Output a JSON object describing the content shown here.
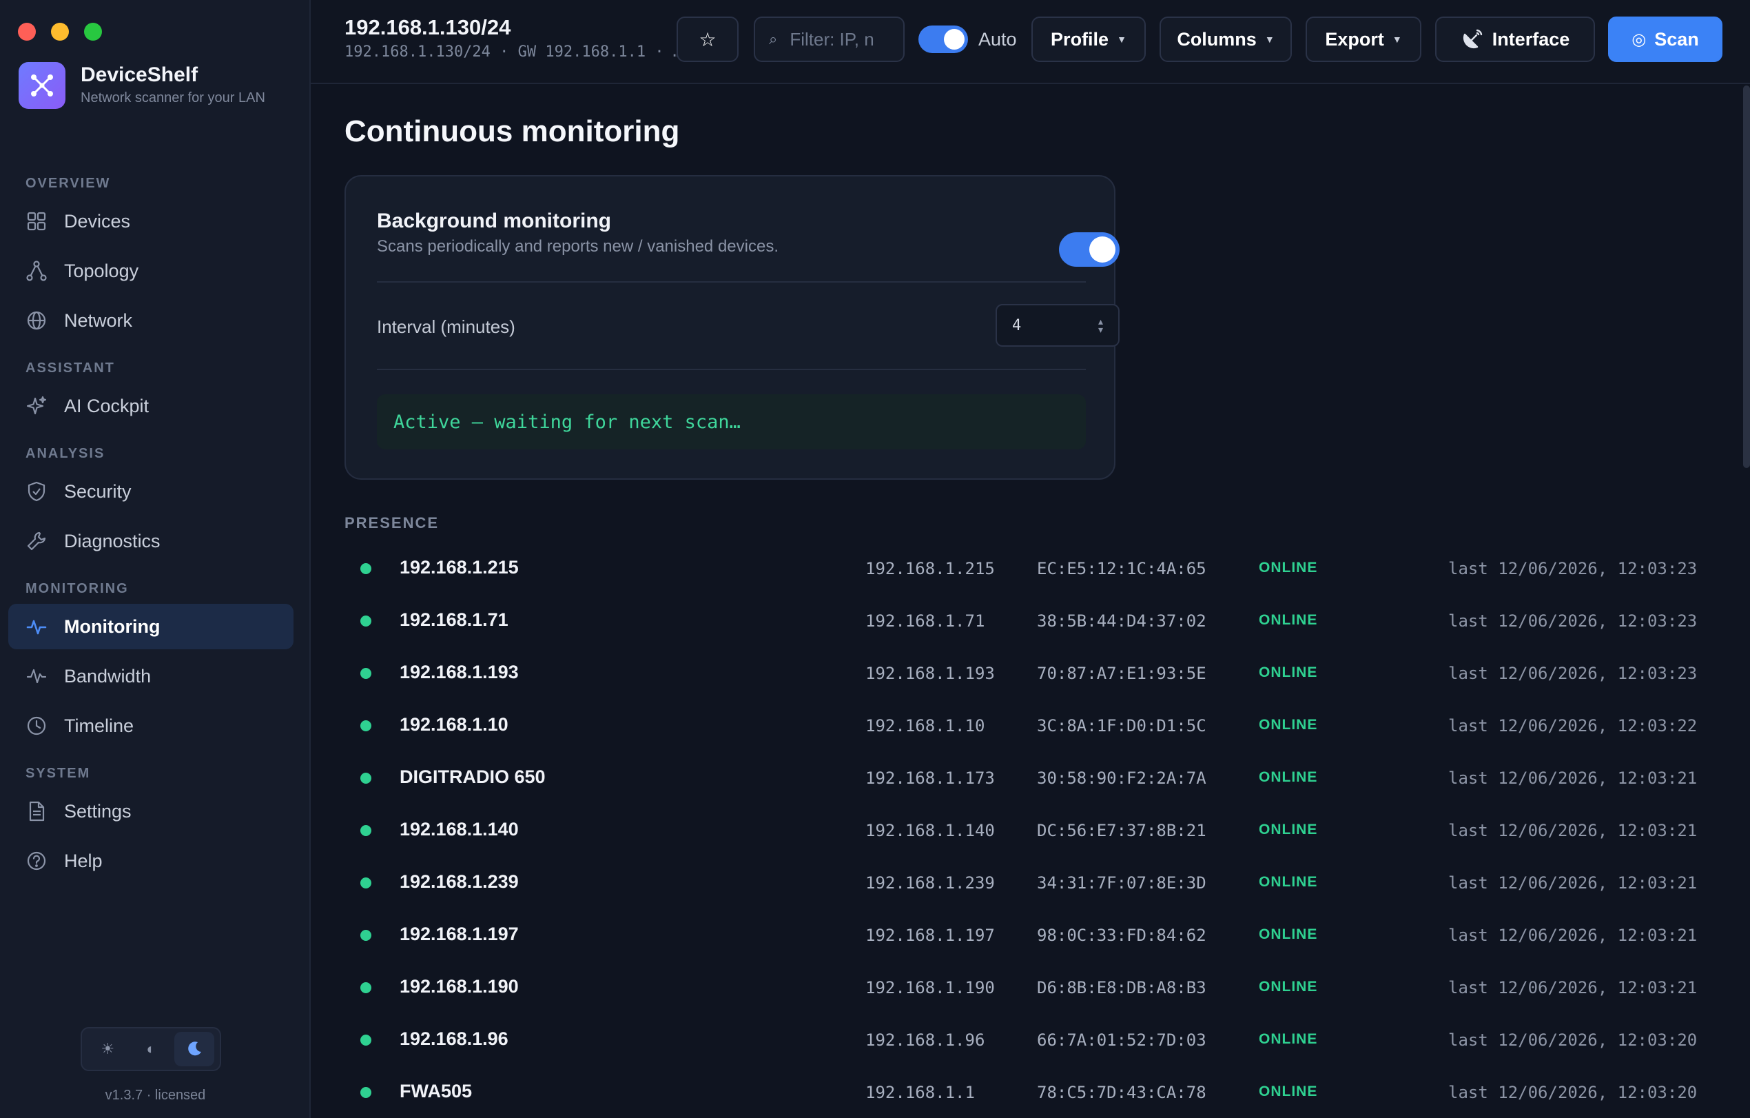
{
  "app": {
    "name": "DeviceShelf",
    "tagline": "Network scanner for your LAN",
    "version": "v1.3.7 · licensed"
  },
  "sidebar": {
    "sections": [
      {
        "title": "OVERVIEW",
        "items": [
          {
            "label": "Devices",
            "icon": "grid-icon"
          },
          {
            "label": "Topology",
            "icon": "topology-icon"
          },
          {
            "label": "Network",
            "icon": "globe-icon"
          }
        ]
      },
      {
        "title": "ASSISTANT",
        "items": [
          {
            "label": "AI Cockpit",
            "icon": "sparkle-icon"
          }
        ]
      },
      {
        "title": "ANALYSIS",
        "items": [
          {
            "label": "Security",
            "icon": "shield-icon"
          },
          {
            "label": "Diagnostics",
            "icon": "wrench-icon"
          }
        ]
      },
      {
        "title": "MONITORING",
        "items": [
          {
            "label": "Monitoring",
            "icon": "pulse-icon",
            "active": true
          },
          {
            "label": "Bandwidth",
            "icon": "activity-icon"
          },
          {
            "label": "Timeline",
            "icon": "clock-icon"
          }
        ]
      },
      {
        "title": "SYSTEM",
        "items": [
          {
            "label": "Settings",
            "icon": "document-icon"
          },
          {
            "label": "Help",
            "icon": "help-icon"
          }
        ]
      }
    ]
  },
  "topbar": {
    "title": "192.168.1.130/24",
    "subtitle": "192.168.1.130/24 · GW 192.168.1.1 · …",
    "search_placeholder": "Filter: IP, n",
    "auto_label": "Auto",
    "profile_label": "Profile",
    "columns_label": "Columns",
    "export_label": "Export",
    "interface_label": "Interface",
    "scan_label": "Scan"
  },
  "page": {
    "title": "Continuous monitoring",
    "card": {
      "title": "Background monitoring",
      "description": "Scans periodically and reports new / vanished devices.",
      "interval_label": "Interval (minutes)",
      "interval_value": "4",
      "status": "Active — waiting for next scan…"
    },
    "presence_title": "PRESENCE",
    "devices": [
      {
        "name": "192.168.1.215",
        "ip": "192.168.1.215",
        "mac": "EC:E5:12:1C:4A:65",
        "status": "ONLINE",
        "last": "last 12/06/2026, 12:03:23"
      },
      {
        "name": "192.168.1.71",
        "ip": "192.168.1.71",
        "mac": "38:5B:44:D4:37:02",
        "status": "ONLINE",
        "last": "last 12/06/2026, 12:03:23"
      },
      {
        "name": "192.168.1.193",
        "ip": "192.168.1.193",
        "mac": "70:87:A7:E1:93:5E",
        "status": "ONLINE",
        "last": "last 12/06/2026, 12:03:23"
      },
      {
        "name": "192.168.1.10",
        "ip": "192.168.1.10",
        "mac": "3C:8A:1F:D0:D1:5C",
        "status": "ONLINE",
        "last": "last 12/06/2026, 12:03:22"
      },
      {
        "name": "DIGITRADIO 650",
        "ip": "192.168.1.173",
        "mac": "30:58:90:F2:2A:7A",
        "status": "ONLINE",
        "last": "last 12/06/2026, 12:03:21"
      },
      {
        "name": "192.168.1.140",
        "ip": "192.168.1.140",
        "mac": "DC:56:E7:37:8B:21",
        "status": "ONLINE",
        "last": "last 12/06/2026, 12:03:21"
      },
      {
        "name": "192.168.1.239",
        "ip": "192.168.1.239",
        "mac": "34:31:7F:07:8E:3D",
        "status": "ONLINE",
        "last": "last 12/06/2026, 12:03:21"
      },
      {
        "name": "192.168.1.197",
        "ip": "192.168.1.197",
        "mac": "98:0C:33:FD:84:62",
        "status": "ONLINE",
        "last": "last 12/06/2026, 12:03:21"
      },
      {
        "name": "192.168.1.190",
        "ip": "192.168.1.190",
        "mac": "D6:8B:E8:DB:A8:B3",
        "status": "ONLINE",
        "last": "last 12/06/2026, 12:03:21"
      },
      {
        "name": "192.168.1.96",
        "ip": "192.168.1.96",
        "mac": "66:7A:01:52:7D:03",
        "status": "ONLINE",
        "last": "last 12/06/2026, 12:03:20"
      },
      {
        "name": "FWA505",
        "ip": "192.168.1.1",
        "mac": "78:C5:7D:43:CA:78",
        "status": "ONLINE",
        "last": "last 12/06/2026, 12:03:20"
      }
    ]
  },
  "colors": {
    "accent": "#3b82f6",
    "online": "#2fd191",
    "background": "#0f1420",
    "sidebar": "#151b29"
  }
}
